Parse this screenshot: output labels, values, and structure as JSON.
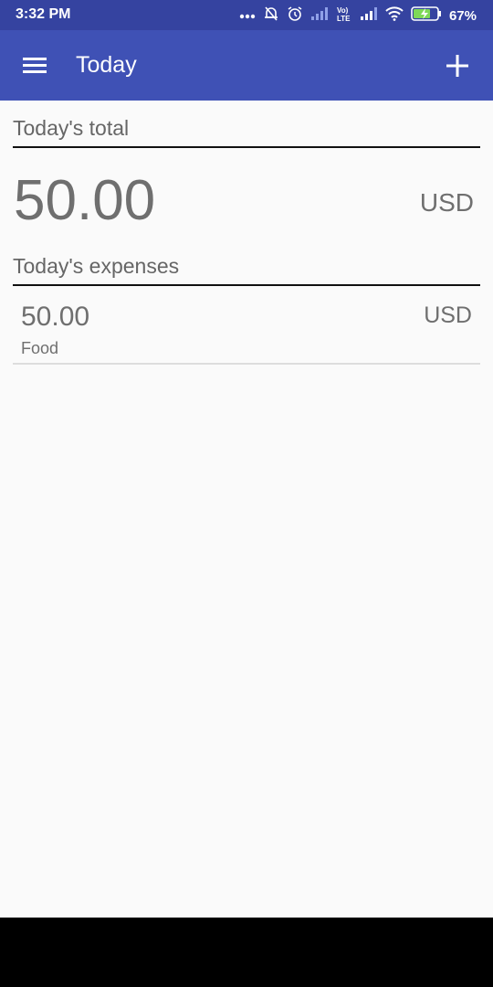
{
  "status_bar": {
    "time": "3:32 PM",
    "battery_percent": "67%",
    "icons": [
      "more-dots-icon",
      "notifications-off-icon",
      "alarm-icon",
      "signal-icon",
      "volte-icon",
      "signal-icon",
      "wifi-icon",
      "battery-charging-icon"
    ],
    "colors": {
      "background": "#3543a0"
    }
  },
  "app_bar": {
    "title": "Today",
    "menu_icon": "hamburger-menu-icon",
    "add_icon": "plus-icon",
    "colors": {
      "background": "#3f51b5"
    }
  },
  "summary": {
    "header": "Today's total",
    "amount": "50.00",
    "currency": "USD"
  },
  "expenses": {
    "header": "Today's expenses",
    "items": [
      {
        "amount": "50.00",
        "currency": "USD",
        "category": "Food"
      }
    ]
  }
}
